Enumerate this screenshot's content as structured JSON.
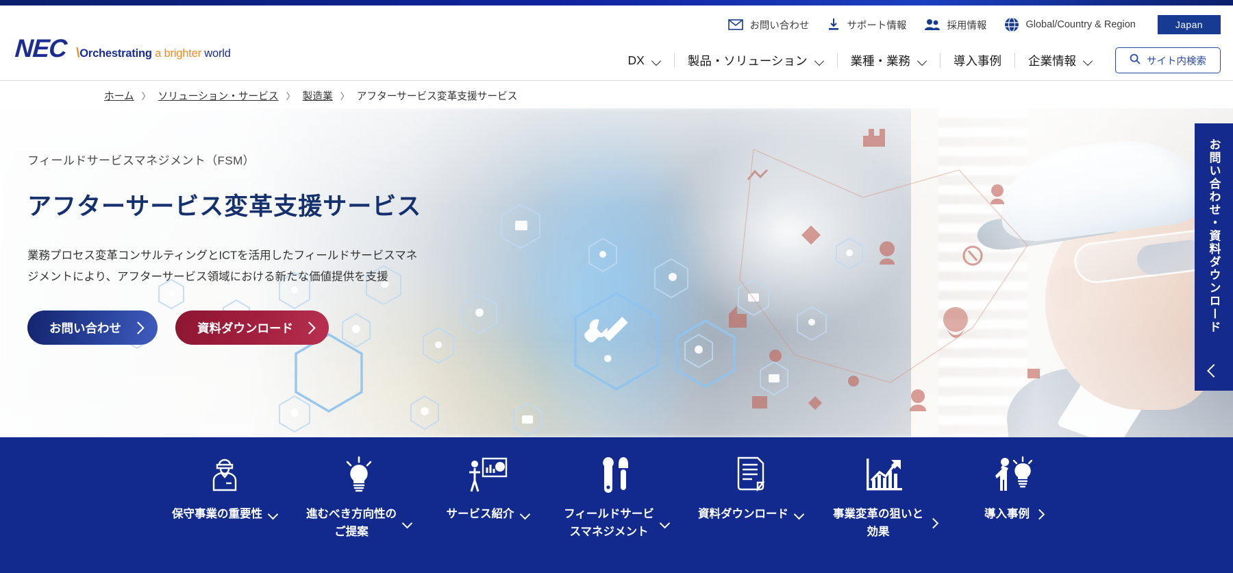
{
  "brand": {
    "logo_text": "NEC",
    "tagline_slash": "\\",
    "tagline_bold": "Orchestrating",
    "tagline_orange": " a brighter",
    "tagline_blue": " world"
  },
  "utility_nav": {
    "items": [
      {
        "label": "お問い合わせ",
        "icon": "mail-icon"
      },
      {
        "label": "サポート情報",
        "icon": "download-icon"
      },
      {
        "label": "採用情報",
        "icon": "people-icon"
      },
      {
        "label": "Global/Country & Region",
        "icon": "globe-icon"
      }
    ],
    "region_button": "Japan"
  },
  "main_nav": {
    "items": [
      {
        "label": "DX",
        "has_dropdown": true
      },
      {
        "label": "製品・ソリューション",
        "has_dropdown": true
      },
      {
        "label": "業種・業務",
        "has_dropdown": true
      },
      {
        "label": "導入事例",
        "has_dropdown": false
      },
      {
        "label": "企業情報",
        "has_dropdown": true
      }
    ],
    "search_label": "サイト内検索"
  },
  "breadcrumb": {
    "items": [
      "ホーム",
      "ソリューション・サービス",
      "製造業",
      "アフターサービス変革支援サービス"
    ],
    "separator": "〉"
  },
  "hero": {
    "eyebrow": "フィールドサービスマネジメント（FSM）",
    "title": "アフターサービス変革支援サービス",
    "description_line1": "業務プロセス変革コンサルティングとICTを活用したフィールドサービスマネ",
    "description_line2": "ジメントにより、アフターサービス領域における新たな価値提供を支援",
    "buttons": [
      {
        "label": "お問い合わせ",
        "style": "primary-blue",
        "color": "#14246e"
      },
      {
        "label": "資料ダウンロード",
        "style": "primary-red",
        "color": "#8c1633"
      }
    ]
  },
  "side_tab": {
    "label": "お問い合わせ・資料ダウンロード",
    "color": "#142a8c"
  },
  "bottom_nav": {
    "background": "#122a8e",
    "items": [
      {
        "label": "保守事業の重要性",
        "icon": "worker-person-icon",
        "chevron": "down"
      },
      {
        "label": "進むべき方向性の\nご提案",
        "icon": "lightbulb-icon",
        "chevron": "down"
      },
      {
        "label": "サービス紹介",
        "icon": "presentation-icon",
        "chevron": "down"
      },
      {
        "label": "フィールドサービ\nスマネジメント",
        "icon": "tools-icon",
        "chevron": "down"
      },
      {
        "label": "資料ダウンロード",
        "icon": "document-icon",
        "chevron": "down"
      },
      {
        "label": "事業変革の狙いと\n効果",
        "icon": "growth-chart-icon",
        "chevron": "right"
      },
      {
        "label": "導入事例",
        "icon": "person-idea-icon",
        "chevron": "right"
      }
    ]
  }
}
